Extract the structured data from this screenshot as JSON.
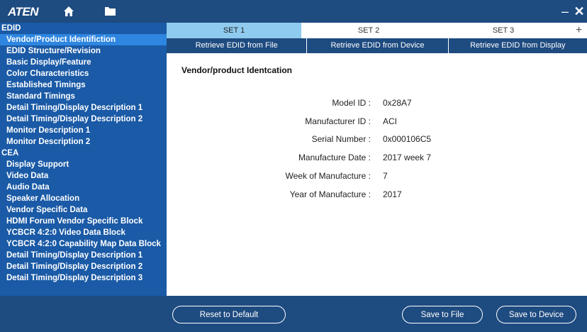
{
  "titlebar": {
    "logo": "ATEN",
    "icons": [
      "home-icon",
      "folder-icon",
      "minimize-icon",
      "close-icon"
    ],
    "minimize_label": "–",
    "close_label": "✕"
  },
  "sidebar": {
    "items": [
      {
        "label": "EDID",
        "type": "header"
      },
      {
        "label": "Vendor/Product Identifiction",
        "type": "item",
        "selected": true
      },
      {
        "label": "EDID Structure/Revision",
        "type": "item"
      },
      {
        "label": "Basic Display/Feature",
        "type": "item"
      },
      {
        "label": "Color Characteristics",
        "type": "item"
      },
      {
        "label": "Established Timings",
        "type": "item"
      },
      {
        "label": "Standard Timings",
        "type": "item"
      },
      {
        "label": "Detail Timing/Display Description 1",
        "type": "item"
      },
      {
        "label": "Detail Timing/Display Description 2",
        "type": "item"
      },
      {
        "label": "Monitor Description 1",
        "type": "item"
      },
      {
        "label": "Monitor Description 2",
        "type": "item"
      },
      {
        "label": "CEA",
        "type": "header"
      },
      {
        "label": "Display Support",
        "type": "item"
      },
      {
        "label": "Video Data",
        "type": "item"
      },
      {
        "label": "Audio Data",
        "type": "item"
      },
      {
        "label": "Speaker Allocation",
        "type": "item"
      },
      {
        "label": "Vendor Specific Data",
        "type": "item"
      },
      {
        "label": "HDMI Forum Vendor Specific Block",
        "type": "item"
      },
      {
        "label": "YCBCR 4:2:0 Video Data Block",
        "type": "item"
      },
      {
        "label": "YCBCR 4:2:0 Capability Map Data Block",
        "type": "item"
      },
      {
        "label": "Detail Timing/Display Description 1",
        "type": "item"
      },
      {
        "label": "Detail Timing/Display Description 2",
        "type": "item"
      },
      {
        "label": "Detail Timing/Display Description 3",
        "type": "item"
      }
    ]
  },
  "set_tabs": {
    "tabs": [
      "SET 1",
      "SET 2",
      "SET 3"
    ],
    "active_index": 0,
    "add_label": "+"
  },
  "actions": {
    "from_file": "Retrieve EDID from File",
    "from_device": "Retrieve EDID from Device",
    "from_display": "Retrieve EDID from Display"
  },
  "section_title": "Vendor/product Identcation",
  "fields": [
    {
      "label": "Model ID :",
      "value": "0x28A7"
    },
    {
      "label": "Manufacturer ID :",
      "value": "ACI"
    },
    {
      "label": "Serial Number :",
      "value": "0x000106C5"
    },
    {
      "label": "Manufacture Date :",
      "value": "2017 week 7"
    },
    {
      "label": "Week of Manufacture :",
      "value": "7"
    },
    {
      "label": "Year of Manufacture :",
      "value": "2017"
    }
  ],
  "footer": {
    "reset_label": "Reset to Default",
    "save_file_label": "Save to File",
    "save_device_label": "Save to Device"
  },
  "colors": {
    "chrome": "#1e4b80",
    "sidebar": "#1a5aa6",
    "sidebar_selected": "#2e86e0",
    "active_tab": "#8ecbef"
  }
}
